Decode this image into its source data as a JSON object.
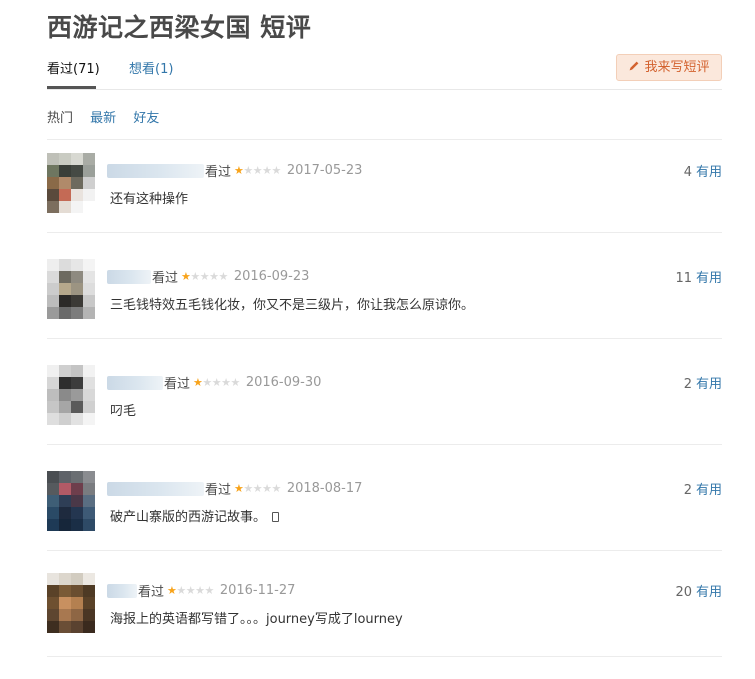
{
  "page": {
    "title": "西游记之西梁女国 短评"
  },
  "tabs": [
    {
      "label": "看过(71)"
    },
    {
      "label": "想看(1)"
    }
  ],
  "write_button": {
    "label": "我来写短评",
    "icon": "pencil-icon"
  },
  "filters": [
    {
      "label": "热门"
    },
    {
      "label": "最新"
    },
    {
      "label": "好友"
    }
  ],
  "comments": [
    {
      "status": "看过",
      "rating": 1,
      "date": "2017-05-23",
      "votes": "4",
      "vote_label": "有用",
      "text": "还有这种操作"
    },
    {
      "status": "看过",
      "rating": 1,
      "date": "2016-09-23",
      "votes": "11",
      "vote_label": "有用",
      "text": "三毛钱特效五毛钱化妆，你又不是三级片，你让我怎么原谅你。"
    },
    {
      "status": "看过",
      "rating": 1,
      "date": "2016-09-30",
      "votes": "2",
      "vote_label": "有用",
      "text": "叼毛"
    },
    {
      "status": "看过",
      "rating": 1,
      "date": "2018-08-17",
      "votes": "2",
      "vote_label": "有用",
      "text": "破产山寨版的西游记故事。",
      "mobile_icon": "phone-icon"
    },
    {
      "status": "看过",
      "rating": 1,
      "date": "2016-11-27",
      "votes": "20",
      "vote_label": "有用",
      "text": "海报上的英语都写错了。。。journey写成了lourney"
    }
  ],
  "colors": {
    "link": "#3377aa",
    "star": "#f8a31a",
    "button_bg": "#fbe8dc",
    "button_text": "#d3622f"
  }
}
